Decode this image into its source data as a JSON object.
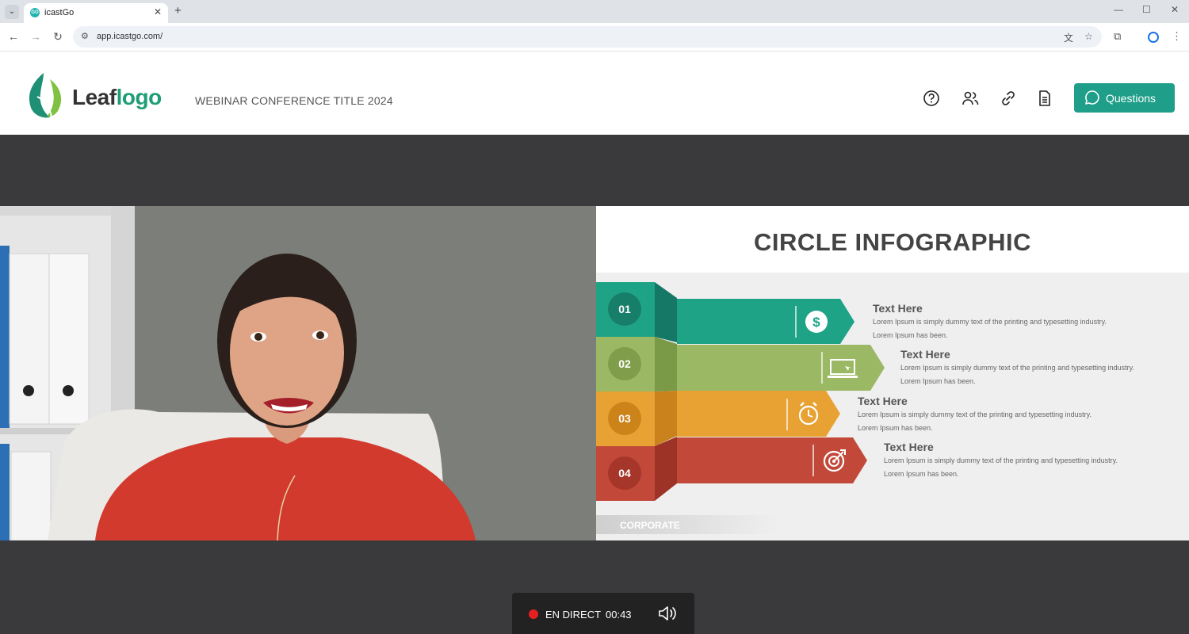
{
  "browser": {
    "tab_title": "icastGo",
    "favicon_text": "GO",
    "url": "app.icastgo.com/"
  },
  "header": {
    "logo_part1": "Leaf",
    "logo_part2": "logo",
    "conference_title": "WEBINAR CONFERENCE TITLE 2024",
    "icons": [
      "help-icon",
      "attendees-icon",
      "link-icon",
      "document-icon"
    ],
    "questions_label": "Questions",
    "accent": "#1f9e89"
  },
  "slide": {
    "title": "CIRCLE INFOGRAPHIC",
    "items": [
      {
        "number": "01",
        "heading": "Text Here",
        "line1": "Lorem Ipsum is simply dummy text of the printing and typesetting industry.",
        "line2": "Lorem Ipsum has been.",
        "icon": "dollar-icon",
        "color": "#1fa386"
      },
      {
        "number": "02",
        "heading": "Text Here",
        "line1": "Lorem Ipsum is simply dummy text of the printing and typesetting industry.",
        "line2": "Lorem Ipsum has been.",
        "icon": "laptop-icon",
        "color": "#9bb864"
      },
      {
        "number": "03",
        "heading": "Text Here",
        "line1": "Lorem Ipsum is simply dummy text of the printing and typesetting industry.",
        "line2": "Lorem Ipsum has been.",
        "icon": "alarm-clock-icon",
        "color": "#e8a233"
      },
      {
        "number": "04",
        "heading": "Text Here",
        "line1": "Lorem Ipsum is simply dummy text of the printing and typesetting industry.",
        "line2": "Lorem Ipsum has been.",
        "icon": "target-icon",
        "color": "#c2493a"
      }
    ],
    "footer_label": "CORPORATE"
  },
  "live": {
    "status": "EN DIRECT",
    "elapsed": "00:43",
    "status_color": "#e62020"
  }
}
